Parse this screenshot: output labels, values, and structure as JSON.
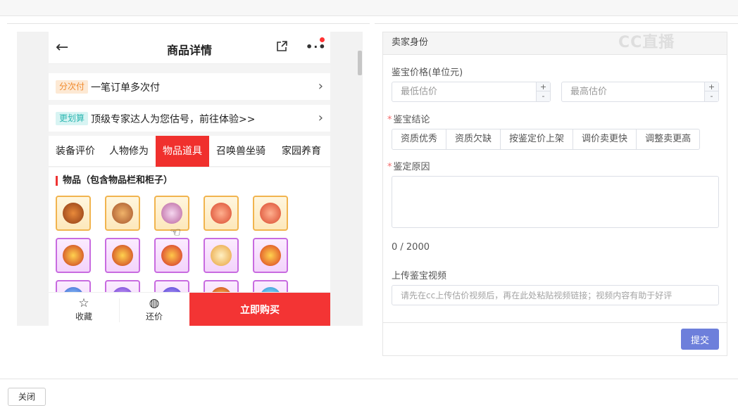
{
  "phone": {
    "nav": {
      "title": "商品详情"
    },
    "installment": {
      "tag": "分次付",
      "text": "一笔订单多次付"
    },
    "estimate": {
      "tag": "更划算",
      "text": "顶级专家达人为您估号，前往体验>>"
    },
    "tabs": [
      {
        "label": "装备评价",
        "active": false
      },
      {
        "label": "人物修为",
        "active": false
      },
      {
        "label": "物品道具",
        "active": true
      },
      {
        "label": "召唤兽坐骑",
        "active": false
      },
      {
        "label": "家园养育",
        "active": false
      }
    ],
    "section_title": "物品（包含物品栏和柜子）",
    "bottom": {
      "favorite": "收藏",
      "bargain": "还价",
      "buy": "立即购买"
    }
  },
  "form": {
    "header": "卖家身份",
    "price_label": "鉴宝价格(单位元)",
    "min_placeholder": "最低估价",
    "max_placeholder": "最高估价",
    "conclusion_label": "鉴宝结论",
    "conclusion_options": [
      "资质优秀",
      "资质欠缺",
      "按鉴定价上架",
      "调价卖更快",
      "调整卖更高"
    ],
    "reason_label": "鉴定原因",
    "counter": "0 / 2000",
    "video_label": "上传鉴宝视频",
    "video_placeholder": "请先在cc上传估价视频后，再在此处粘贴视频链接；视频内容有助于好评",
    "submit": "提交"
  },
  "watermark": "CC直播",
  "footer": {
    "close": "关闭"
  }
}
